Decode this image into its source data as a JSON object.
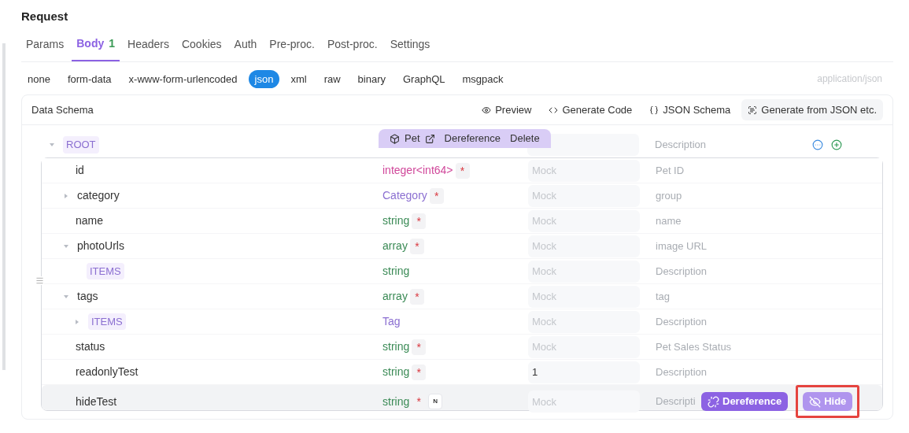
{
  "title": "Request",
  "tabs": [
    {
      "label": "Params",
      "selected": false
    },
    {
      "label": "Body",
      "count": "1",
      "selected": true
    },
    {
      "label": "Headers",
      "selected": false
    },
    {
      "label": "Cookies",
      "selected": false
    },
    {
      "label": "Auth",
      "selected": false
    },
    {
      "label": "Pre-proc.",
      "selected": false
    },
    {
      "label": "Post-proc.",
      "selected": false
    },
    {
      "label": "Settings",
      "selected": false
    }
  ],
  "body_types": [
    {
      "label": "none",
      "selected": false
    },
    {
      "label": "form-data",
      "selected": false
    },
    {
      "label": "x-www-form-urlencoded",
      "selected": false
    },
    {
      "label": "json",
      "selected": true
    },
    {
      "label": "xml",
      "selected": false
    },
    {
      "label": "raw",
      "selected": false
    },
    {
      "label": "binary",
      "selected": false
    },
    {
      "label": "GraphQL",
      "selected": false
    },
    {
      "label": "msgpack",
      "selected": false
    }
  ],
  "content_type": "application/json",
  "schema": {
    "title": "Data Schema",
    "tools": [
      {
        "kind": "preview",
        "label": "Preview"
      },
      {
        "kind": "code",
        "label": "Generate Code"
      },
      {
        "kind": "schema",
        "label": "JSON Schema"
      },
      {
        "kind": "generate",
        "label": "Generate from JSON etc."
      }
    ],
    "required_mark": "*",
    "root": {
      "label": "ROOT",
      "expanded": true,
      "description": {
        "placeholder": "Description"
      },
      "ref_bar": {
        "name": "Pet",
        "actions": [
          "Dereference",
          "Delete"
        ]
      }
    },
    "rows": [
      {
        "name": "id",
        "badge": false,
        "hovered": false,
        "type": {
          "label": "integer<int64>",
          "kind": "integer"
        },
        "required": true,
        "nullable": false,
        "mock": {
          "placeholder": "Mock"
        },
        "description": {
          "placeholder": "Pet ID"
        }
      },
      {
        "name": "category",
        "badge": false,
        "hovered": false,
        "expanded": false,
        "type": {
          "label": "Category",
          "kind": "ref"
        },
        "required": true,
        "nullable": false,
        "mock": {
          "placeholder": "Mock"
        },
        "description": {
          "placeholder": "group"
        }
      },
      {
        "name": "name",
        "badge": false,
        "hovered": false,
        "type": {
          "label": "string",
          "kind": "primitive"
        },
        "required": true,
        "nullable": false,
        "mock": {
          "placeholder": "Mock"
        },
        "description": {
          "placeholder": "name"
        }
      },
      {
        "name": "photoUrls",
        "badge": false,
        "hovered": false,
        "expanded": true,
        "type": {
          "label": "array",
          "kind": "primitive"
        },
        "required": true,
        "nullable": false,
        "mock": {
          "placeholder": "Mock"
        },
        "description": {
          "placeholder": "image URL"
        },
        "children": [
          {
            "name": "ITEMS",
            "badge": true,
            "hovered": false,
            "type": {
              "label": "string",
              "kind": "primitive"
            },
            "required": false,
            "nullable": false,
            "mock": {
              "placeholder": "Mock"
            },
            "description": {
              "placeholder": "Description"
            }
          }
        ]
      },
      {
        "name": "tags",
        "badge": false,
        "hovered": false,
        "expanded": true,
        "type": {
          "label": "array",
          "kind": "primitive"
        },
        "required": true,
        "nullable": false,
        "mock": {
          "placeholder": "Mock"
        },
        "description": {
          "placeholder": "tag"
        },
        "children": [
          {
            "name": "ITEMS",
            "badge": true,
            "hovered": false,
            "expanded": false,
            "type": {
              "label": "Tag",
              "kind": "ref"
            },
            "required": false,
            "nullable": false,
            "mock": {
              "placeholder": "Mock"
            },
            "description": {
              "placeholder": "Description"
            }
          }
        ]
      },
      {
        "name": "status",
        "badge": false,
        "hovered": false,
        "type": {
          "label": "string",
          "kind": "primitive"
        },
        "required": true,
        "nullable": false,
        "mock": {
          "placeholder": "Mock"
        },
        "description": {
          "placeholder": "Pet Sales Status"
        }
      },
      {
        "name": "readonlyTest",
        "badge": false,
        "hovered": false,
        "type": {
          "label": "string",
          "kind": "primitive"
        },
        "required": true,
        "nullable": false,
        "mock": {
          "value": "1"
        },
        "description": {
          "placeholder": "Description"
        }
      },
      {
        "name": "hideTest",
        "badge": false,
        "hovered": true,
        "type": {
          "label": "string",
          "kind": "primitive"
        },
        "required": true,
        "nullable": true,
        "nullable_mark": "N",
        "mock": {
          "placeholder": "Mock"
        },
        "description": {
          "placeholder": "Descripti"
        },
        "actions": [
          {
            "kind": "dereference",
            "label": "Dereference",
            "highlighted": false
          },
          {
            "kind": "hide",
            "label": "Hide",
            "highlighted": true
          }
        ]
      }
    ]
  }
}
